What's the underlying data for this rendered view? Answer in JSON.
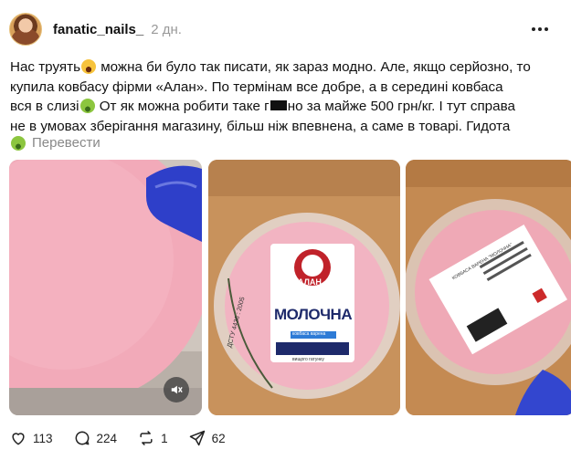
{
  "post": {
    "username": "fanatic_nails_",
    "time": "2 дн.",
    "text": {
      "line1_a": "Нас труять",
      "line1_b": " можна би було так писати, як зараз модно. Але, якщо серйозно, то",
      "line2": "купила ковбасу фірми «Алан». По термінам все добре, а в середині ковбаса",
      "line3_a": "вся в слизі",
      "line3_b": " От як можна робити таке г",
      "line3_c": "но за майже 500 грн/кг. І тут справа",
      "line4": "не в умовах зберігання магазину, більш ніж впевнена, а саме в товарі. Гидота"
    },
    "translate_label": "Перевести",
    "icons": {
      "more": "more-horizontal-icon",
      "translate": "sick-face-emoji"
    },
    "images": [
      {
        "id": "photo-1",
        "desc_icon": "sausage-slice-photo"
      },
      {
        "id": "photo-2",
        "brand": "АЛАН",
        "label_main": "МОЛОЧНА",
        "label_badge": "ковбаса варена",
        "label_side": "ДСТУ 4436 : 2005",
        "label_foot": "вищого гатунку"
      },
      {
        "id": "photo-3",
        "label_title": "КОВБАСА ВАРЕНА \"МОЛОЧНА\""
      }
    ],
    "actions": {
      "likes": "113",
      "comments": "224",
      "reposts": "1",
      "shares": "62"
    }
  },
  "colors": {
    "muted_text": "#999999",
    "sausage_pink": "#f0a8b4",
    "glove_blue": "#3a4fd6"
  }
}
